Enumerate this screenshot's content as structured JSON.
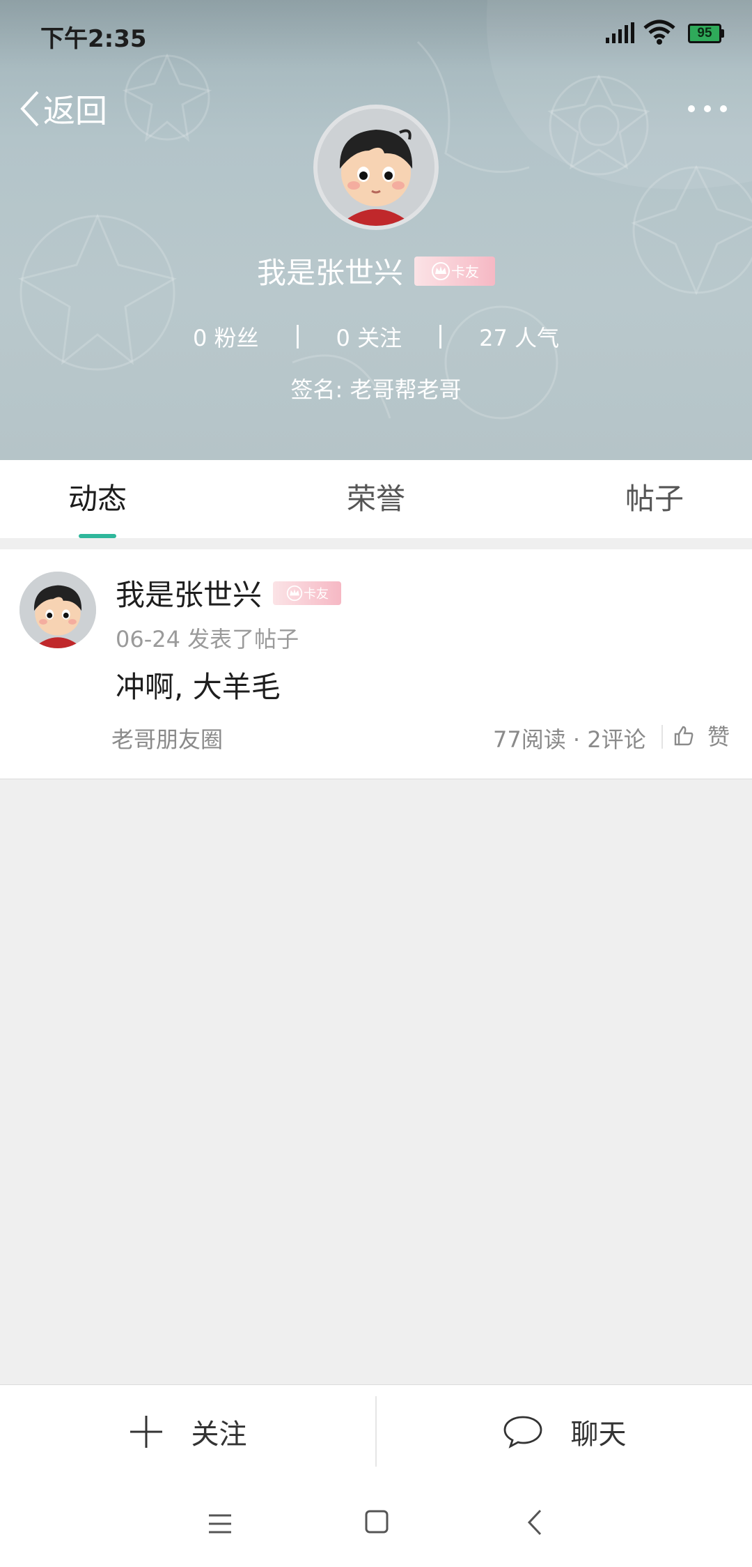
{
  "status_bar": {
    "time": "下午2:35",
    "battery": "95"
  },
  "header": {
    "back_label": "返回",
    "profile_name": "我是张世兴",
    "badge_label": "卡友",
    "stats": [
      "0 粉丝",
      "0 关注",
      "27 人气"
    ],
    "signature": "签名: 老哥帮老哥"
  },
  "tabs": [
    {
      "label": "动态",
      "active": true
    },
    {
      "label": "荣誉",
      "active": false
    },
    {
      "label": "帖子",
      "active": false
    }
  ],
  "feed": {
    "items": [
      {
        "author": "我是张世兴",
        "badge": "卡友",
        "meta": "06-24  发表了帖子",
        "content": "冲啊, 大羊毛",
        "circle": "老哥朋友圈",
        "stats": "77阅读 · 2评论",
        "like_label": "赞"
      }
    ]
  },
  "action_bar": {
    "follow_label": "关注",
    "chat_label": "聊天"
  },
  "colors": {
    "accent": "#2fb79b",
    "header_bg": "#b3c4c9",
    "badge_pink": "#f6b8c4"
  },
  "icons": [
    "signal-icon",
    "wifi-icon",
    "battery-icon",
    "back-chevron-icon",
    "more-icon",
    "thumbs-up-icon",
    "plus-icon",
    "chat-bubble-icon",
    "nav-menu-icon",
    "nav-home-icon",
    "nav-back-icon"
  ]
}
